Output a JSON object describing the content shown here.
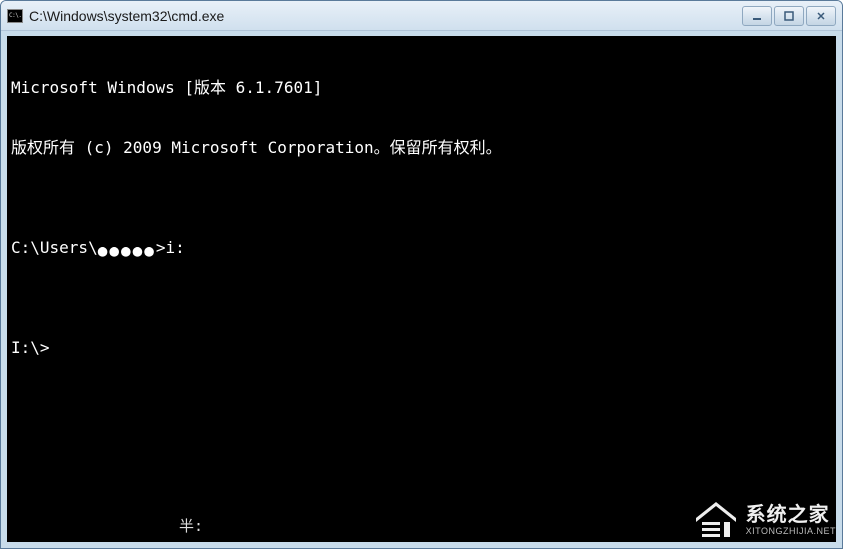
{
  "window": {
    "title": "C:\\Windows\\system32\\cmd.exe",
    "icon_label": "C:\\."
  },
  "terminal": {
    "line1": "Microsoft Windows [版本 6.1.7601]",
    "line2": "版权所有 (c) 2009 Microsoft Corporation。保留所有权利。",
    "blank1": "",
    "prompt1_prefix": "C:\\Users\\",
    "prompt1_user_mask": "●●●●●",
    "prompt1_suffix": ">i:",
    "blank2": "",
    "prompt2": "I:\\>",
    "input_method": "半:"
  },
  "watermark": {
    "main": "系统之家",
    "sub": "XITONGZHIJIA.NET"
  }
}
